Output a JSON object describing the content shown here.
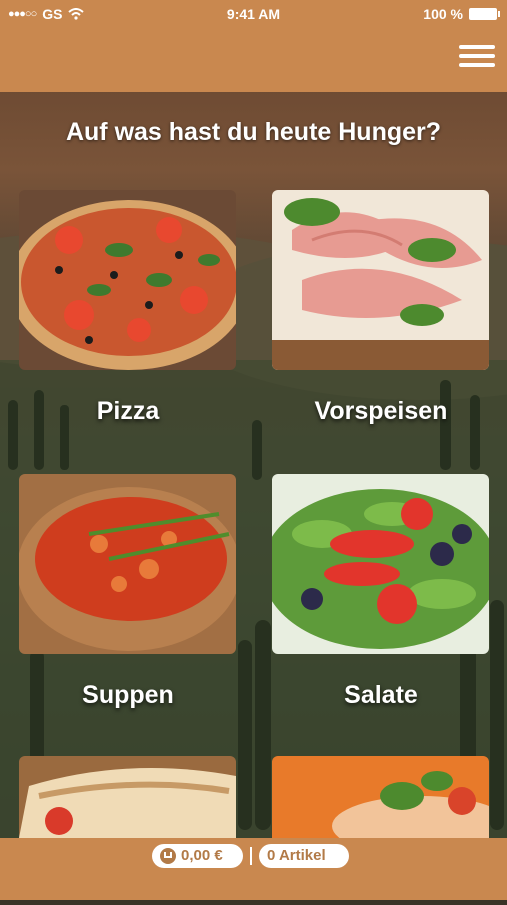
{
  "status_bar": {
    "carrier": "GS",
    "time": "9:41 AM",
    "battery": "100 %"
  },
  "header": {
    "menu_icon": "hamburger-menu-icon"
  },
  "main": {
    "title": "Auf was hast du heute Hunger?",
    "categories": [
      {
        "label": "Pizza"
      },
      {
        "label": "Vorspeisen"
      },
      {
        "label": "Suppen"
      },
      {
        "label": "Salate"
      }
    ]
  },
  "footer": {
    "cart_total": "0,00 €",
    "cart_items": "0 Artikel",
    "cart_icon": "cart-icon"
  },
  "colors": {
    "brand": "#c9884f",
    "text": "#ffffff"
  }
}
